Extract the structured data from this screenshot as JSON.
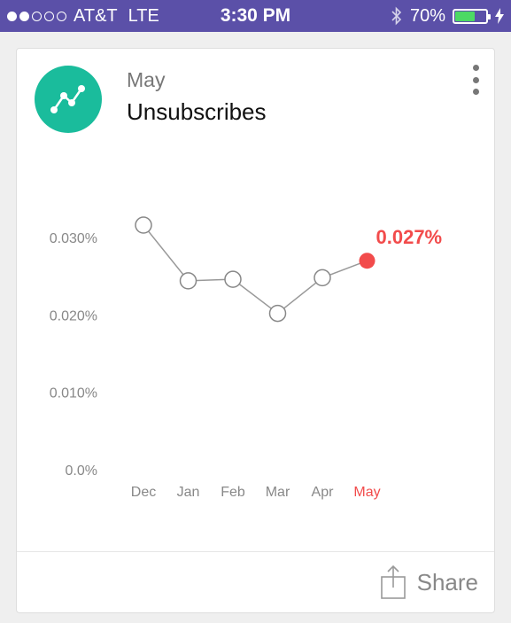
{
  "status_bar": {
    "carrier": "AT&T",
    "network": "LTE",
    "time": "3:30 PM",
    "battery_percent": "70%",
    "battery_level": 0.7,
    "signal_bars": 2,
    "signal_total": 5
  },
  "card": {
    "month": "May",
    "title": "Unsubscribes",
    "accent_color": "#1abc9c",
    "highlight_color": "#f24b4b",
    "icon": "trend-line-icon",
    "share_label": "Share"
  },
  "chart_data": {
    "type": "line",
    "categories": [
      "Dec",
      "Jan",
      "Feb",
      "Mar",
      "Apr",
      "May"
    ],
    "values": [
      0.0316,
      0.0244,
      0.0246,
      0.0202,
      0.0248,
      0.027
    ],
    "ylim": [
      0,
      0.03
    ],
    "yticks": [
      "0.030%",
      "0.020%",
      "0.010%",
      "0.0%"
    ],
    "highlight_label": "0.027%",
    "highlight_index": 5
  }
}
